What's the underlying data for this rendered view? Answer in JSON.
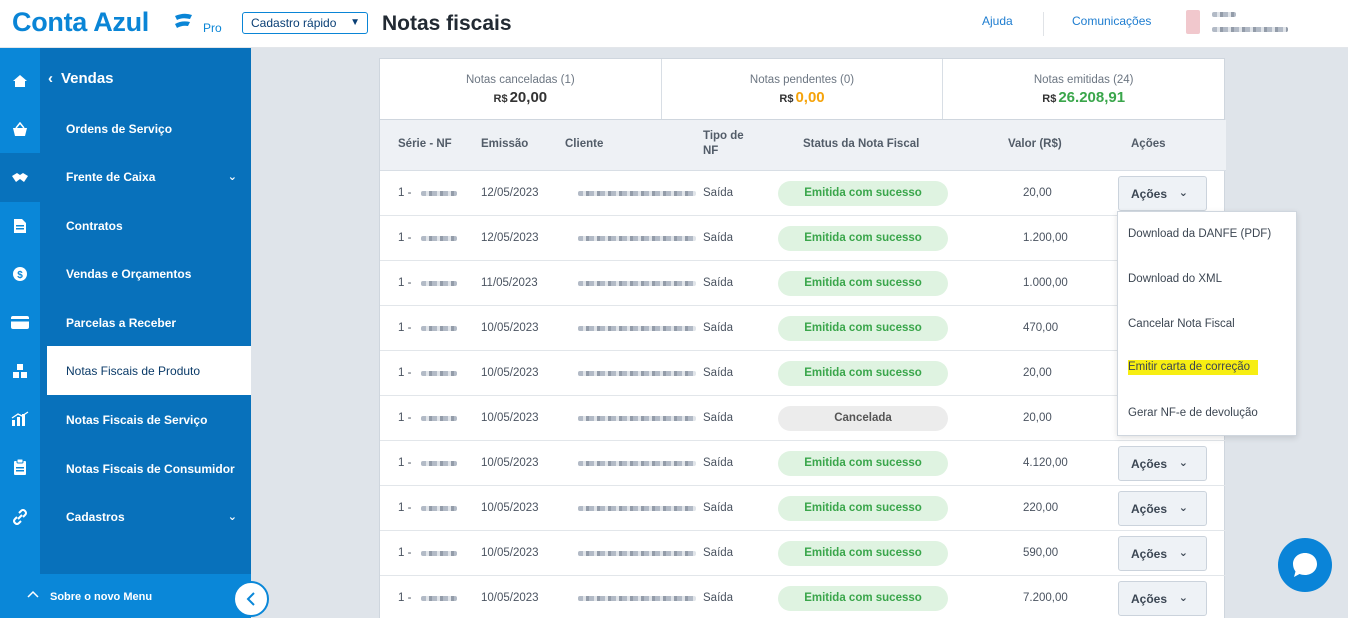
{
  "header": {
    "logo_text": "Conta Azul",
    "logo_plan": "Pro",
    "quick_register_label": "Cadastro rápido",
    "page_title": "Notas fiscais",
    "help_label": "Ajuda",
    "communications_label": "Comunicações"
  },
  "sidebar": {
    "back_label": "Vendas",
    "items": [
      {
        "label": "Ordens de Serviço",
        "has_chevron": false,
        "active": false
      },
      {
        "label": "Frente de Caixa",
        "has_chevron": true,
        "active": false
      },
      {
        "label": "Contratos",
        "has_chevron": false,
        "active": false
      },
      {
        "label": "Vendas e Orçamentos",
        "has_chevron": false,
        "active": false
      },
      {
        "label": "Parcelas a Receber",
        "has_chevron": false,
        "active": false
      },
      {
        "label": "Notas Fiscais de Produto",
        "has_chevron": false,
        "active": true
      },
      {
        "label": "Notas Fiscais de Serviço",
        "has_chevron": false,
        "active": false
      },
      {
        "label": "Notas Fiscais de Consumidor",
        "has_chevron": false,
        "active": false
      },
      {
        "label": "Cadastros",
        "has_chevron": true,
        "active": false
      }
    ],
    "rail_icons": [
      "home-icon",
      "basket-icon",
      "handshake-icon",
      "document-icon",
      "dollar-icon",
      "card-icon",
      "boxes-icon",
      "chart-icon",
      "clipboard-icon",
      "link-icon"
    ],
    "footer_label": "Sobre o novo Menu"
  },
  "summary": {
    "currency": "R$",
    "cards": [
      {
        "label": "Notas canceladas (1)",
        "value": "20,00",
        "color": "#333333"
      },
      {
        "label": "Notas pendentes (0)",
        "value": "0,00",
        "color": "#f5a30a"
      },
      {
        "label": "Notas emitidas (24)",
        "value": "26.208,91",
        "color": "#3aa64b"
      }
    ]
  },
  "table": {
    "headers": {
      "serie": "Série - NF",
      "emissao": "Emissão",
      "cliente": "Cliente",
      "tipo_line1": "Tipo de",
      "tipo_line2": "NF",
      "status": "Status da Nota Fiscal",
      "valor": "Valor (R$)",
      "acoes": "Ações"
    },
    "rows": [
      {
        "serie": "1 -",
        "emissao": "12/05/2023",
        "tipo": "Saída",
        "status": "Emitida com sucesso",
        "status_type": "ok",
        "valor": "20,00",
        "acoes": "Ações"
      },
      {
        "serie": "1 -",
        "emissao": "12/05/2023",
        "tipo": "Saída",
        "status": "Emitida com sucesso",
        "status_type": "ok",
        "valor": "1.200,00",
        "acoes": ""
      },
      {
        "serie": "1 -",
        "emissao": "11/05/2023",
        "tipo": "Saída",
        "status": "Emitida com sucesso",
        "status_type": "ok",
        "valor": "1.000,00",
        "acoes": ""
      },
      {
        "serie": "1 -",
        "emissao": "10/05/2023",
        "tipo": "Saída",
        "status": "Emitida com sucesso",
        "status_type": "ok",
        "valor": "470,00",
        "acoes": ""
      },
      {
        "serie": "1 -",
        "emissao": "10/05/2023",
        "tipo": "Saída",
        "status": "Emitida com sucesso",
        "status_type": "ok",
        "valor": "20,00",
        "acoes": ""
      },
      {
        "serie": "1 -",
        "emissao": "10/05/2023",
        "tipo": "Saída",
        "status": "Cancelada",
        "status_type": "cancel",
        "valor": "20,00",
        "acoes": ""
      },
      {
        "serie": "1 -",
        "emissao": "10/05/2023",
        "tipo": "Saída",
        "status": "Emitida com sucesso",
        "status_type": "ok",
        "valor": "4.120,00",
        "acoes": "Ações"
      },
      {
        "serie": "1 -",
        "emissao": "10/05/2023",
        "tipo": "Saída",
        "status": "Emitida com sucesso",
        "status_type": "ok",
        "valor": "220,00",
        "acoes": "Ações"
      },
      {
        "serie": "1 -",
        "emissao": "10/05/2023",
        "tipo": "Saída",
        "status": "Emitida com sucesso",
        "status_type": "ok",
        "valor": "590,00",
        "acoes": "Ações"
      },
      {
        "serie": "1 -",
        "emissao": "10/05/2023",
        "tipo": "Saída",
        "status": "Emitida com sucesso",
        "status_type": "ok",
        "valor": "7.200,00",
        "acoes": "Ações"
      }
    ]
  },
  "actions_menu": {
    "items": [
      {
        "label": "Download da DANFE (PDF)",
        "highlighted": false
      },
      {
        "label": "Download do XML",
        "highlighted": false
      },
      {
        "label": "Cancelar Nota Fiscal",
        "highlighted": false
      },
      {
        "label": "Emitir carta de correção",
        "highlighted": true
      },
      {
        "label": "Gerar NF-e de devolução",
        "highlighted": false
      }
    ]
  },
  "colors": {
    "brand_blue": "#0a85d6",
    "sidebar_dark": "#0871bb",
    "success_green": "#3aa64b",
    "warning_orange": "#f5a30a",
    "highlight_yellow": "#f7ee12"
  }
}
